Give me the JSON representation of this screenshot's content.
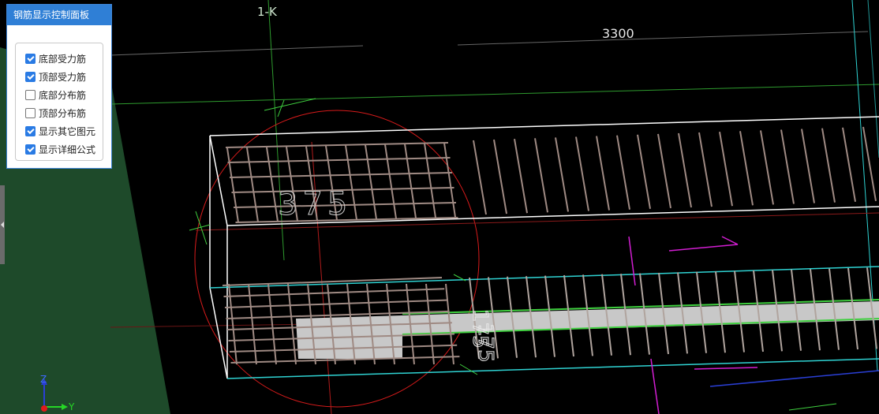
{
  "panel": {
    "title": "钢筋显示控制面板",
    "options": [
      {
        "label": "底部受力筋",
        "checked": true
      },
      {
        "label": "顶部受力筋",
        "checked": true
      },
      {
        "label": "底部分布筋",
        "checked": false
      },
      {
        "label": "顶部分布筋",
        "checked": false
      },
      {
        "label": "显示其它图元",
        "checked": true
      },
      {
        "label": "显示详细公式",
        "checked": true
      }
    ]
  },
  "viewport": {
    "axis_label": "1-K",
    "dimension_top": "3300",
    "dimension_front": "375",
    "dimension_side_1": "175",
    "dimension_side_2": "175",
    "triad": {
      "z": "Z",
      "y": "Y"
    }
  },
  "colors": {
    "panel_header": "#2f7fd6",
    "checkbox_on": "#2a7be4",
    "background": "#000000",
    "ground": "#1e4a2a",
    "slab_outline": "#ffffff",
    "rebar": "#9f8a83",
    "grid_green": "#3fa83f",
    "cyan_line": "#2fd3d3",
    "magenta": "#d21ed2",
    "red_circle": "#d81b1b"
  }
}
